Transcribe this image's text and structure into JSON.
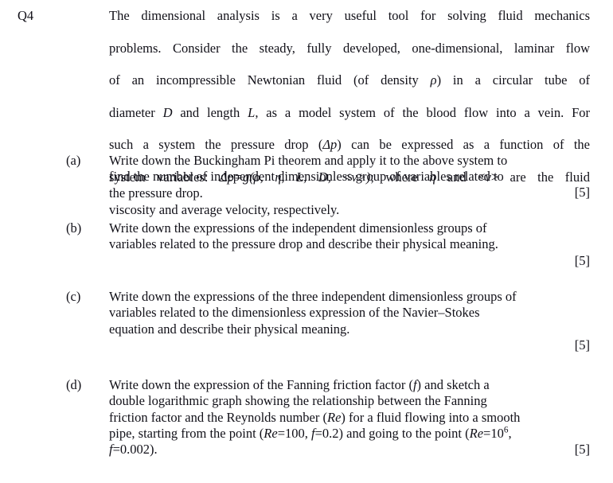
{
  "document": {
    "question_label": "Q4",
    "intro": {
      "lines": [
        "The dimensional analysis is a very useful tool for solving fluid mechanics",
        "problems. Consider the steady, fully developed, one-dimensional, laminar flow",
        "of an incompressible Newtonian fluid (of density ρ) in a circular tube of",
        "diameter D and length L, as a model system of the blood flow into a vein. For",
        "such a system the pressure drop (Δp) can be expressed as a function of the",
        "system variables: Δp=g(ρ, η, L, D, <v>); where η and <v> are the fluid",
        "viscosity and average velocity, respectively."
      ],
      "full_text": "The dimensional analysis is a very useful tool for solving fluid mechanics problems. Consider the steady, fully developed, one-dimensional, laminar flow of an incompressible Newtonian fluid (of density ρ) in a circular tube of diameter D and length L, as a model system of the blood flow into a vein. For such a system the pressure drop (Δp) can be expressed as a function of the system variables: Δp=g(ρ, η, L, D, <v>); where η and <v> are the fluid viscosity and average velocity, respectively.",
      "segments": {
        "l1": "The dimensional analysis is a very useful tool for solving fluid mechanics",
        "l2": "problems. Consider the steady, fully developed, one-dimensional, laminar flow",
        "l3a": "of an incompressible Newtonian fluid (of density ",
        "l3_rho": "ρ",
        "l3b": ") in a circular tube of",
        "l4a": "diameter ",
        "l4_D": "D",
        "l4b": " and length ",
        "l4_L": "L",
        "l4c": ", as a model system of the blood flow into a vein. For",
        "l5a": "such a system the pressure drop (",
        "l5_dp": "Δp",
        "l5b": ") can be expressed as a function of the",
        "l6a": "system variables: ",
        "l6_eq": "Δp=g(ρ, η, L, D, <v>)",
        "l6b": "; where ",
        "l6_eta": "η",
        "l6c": " and <",
        "l6_v": "v",
        "l6d": "> are the fluid",
        "l7": "viscosity and average velocity, respectively."
      }
    },
    "parts": [
      {
        "label": "(a)",
        "marks": "[5]",
        "text": "Write down the Buckingham Pi theorem and apply it to the above system to find the number of independent dimensionless group of variables related to the pressure drop.",
        "lines": [
          "Write down the Buckingham Pi theorem and apply it to the above system to",
          "find the number of independent dimensionless group of variables related to",
          "the pressure drop."
        ]
      },
      {
        "label": "(b)",
        "marks": "[5]",
        "text": "Write down the expressions of the independent dimensionless groups of variables related to the pressure drop and describe their physical meaning.",
        "lines": [
          "Write down the expressions of the independent dimensionless groups of",
          "variables related to the pressure drop and describe their physical meaning."
        ]
      },
      {
        "label": "(c)",
        "marks": "[5]",
        "text": "Write down the expressions of the three independent dimensionless groups of variables related to the dimensionless expression of the Navier–Stokes equation and describe their physical meaning.",
        "lines": [
          "Write down the expressions of the three independent dimensionless groups of",
          "variables related to the dimensionless expression of the Navier–Stokes",
          "equation and describe their physical meaning."
        ]
      },
      {
        "label": "(d)",
        "marks": "[5]",
        "text": "Write down the expression of the Fanning friction factor (f) and sketch a double logarithmic graph showing the relationship between the Fanning friction factor and the Reynolds number (Re) for a fluid flowing into a smooth pipe, starting from the point (Re=100, f=0.2) and going to the point (Re=10^6, f=0.002).",
        "segments": {
          "l1a": "Write down the expression of the Fanning friction factor (",
          "l1_f": "f",
          "l1b": ") and sketch a",
          "l2": "double logarithmic graph showing the relationship between the Fanning",
          "l3a": "friction factor and the Reynolds number (",
          "l3_Re": "Re",
          "l3b": ") for a fluid flowing into a smooth",
          "l4a": "pipe, starting from the point (",
          "l4_Re": "Re",
          "l4b": "=100, ",
          "l4_f": "f",
          "l4c": "=0.2) and going to the point (",
          "l4_Re2": "Re",
          "l4d": "=10",
          "l4_sup": "6",
          "l4e": ",",
          "l5_f": "f",
          "l5b": "=0.002)."
        }
      }
    ]
  }
}
